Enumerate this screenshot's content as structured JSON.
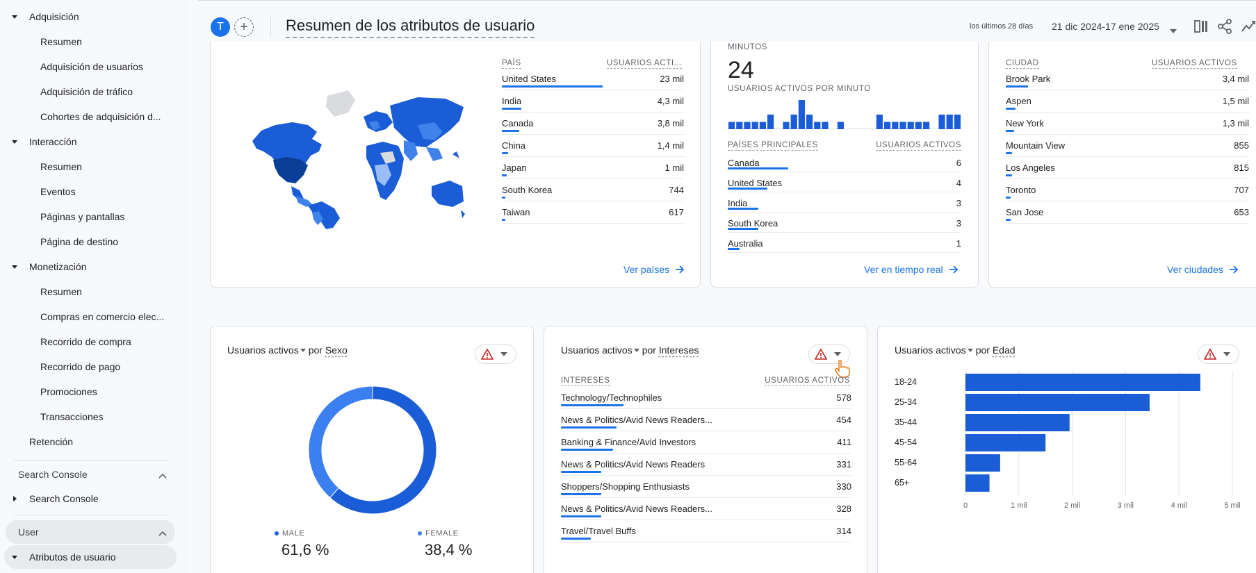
{
  "sidebar": {
    "items": [
      {
        "label": "Adquisición",
        "level": 1,
        "caret": "down"
      },
      {
        "label": "Resumen",
        "level": 2
      },
      {
        "label": "Adquisición de usuarios",
        "level": 2
      },
      {
        "label": "Adquisición de tráfico",
        "level": 2
      },
      {
        "label": "Cohortes de adquisición d...",
        "level": 2
      },
      {
        "label": "Interacción",
        "level": 1,
        "caret": "down"
      },
      {
        "label": "Resumen",
        "level": 2
      },
      {
        "label": "Eventos",
        "level": 2
      },
      {
        "label": "Páginas y pantallas",
        "level": 2
      },
      {
        "label": "Página de destino",
        "level": 2
      },
      {
        "label": "Monetización",
        "level": 1,
        "caret": "down"
      },
      {
        "label": "Resumen",
        "level": 2
      },
      {
        "label": "Compras en comercio elec...",
        "level": 2
      },
      {
        "label": "Recorrido de compra",
        "level": 2
      },
      {
        "label": "Recorrido de pago",
        "level": 2
      },
      {
        "label": "Promociones",
        "level": 2
      },
      {
        "label": "Transacciones",
        "level": 2
      },
      {
        "label": "Retención",
        "level": 1
      }
    ],
    "section_search": "Search Console",
    "search_item": "Search Console",
    "section_user": "User",
    "user_item": "Atributos de usuario"
  },
  "header": {
    "avatar": "T",
    "add": "+",
    "title": "Resumen de los atributos de usuario",
    "date_prefix": "los últimos 28 días",
    "date_range": "21 dic 2024-17 ene 2025"
  },
  "country_card": {
    "col_country": "PAÍS",
    "col_users": "USUARIOS ACTI...",
    "rows": [
      {
        "label": "United States",
        "value": "23 mil",
        "pct": 1.0
      },
      {
        "label": "India",
        "value": "4,3 mil",
        "pct": 0.19
      },
      {
        "label": "Canada",
        "value": "3,8 mil",
        "pct": 0.17
      },
      {
        "label": "China",
        "value": "1,4 mil",
        "pct": 0.06
      },
      {
        "label": "Japan",
        "value": "1 mil",
        "pct": 0.045
      },
      {
        "label": "South Korea",
        "value": "744",
        "pct": 0.035
      },
      {
        "label": "Taiwan",
        "value": "617",
        "pct": 0.03
      }
    ],
    "link": "Ver países"
  },
  "realtime_card": {
    "top_label": "MINUTOS",
    "big_number": "24",
    "per_minute_label": "USUARIOS ACTIVOS POR MINUTO",
    "minute_bars": [
      1,
      1,
      1,
      1,
      1,
      2,
      0,
      1,
      2,
      4,
      2,
      1,
      1,
      0,
      1,
      0,
      0,
      0,
      0,
      2,
      1,
      1,
      1,
      1,
      1,
      1,
      0,
      2,
      2,
      2
    ],
    "col_country": "PAÍSES PRINCIPALES",
    "col_users": "USUARIOS ACTIVOS",
    "rows": [
      {
        "label": "Canada",
        "value": "6",
        "pct": 0.26
      },
      {
        "label": "United States",
        "value": "4",
        "pct": 0.17
      },
      {
        "label": "India",
        "value": "3",
        "pct": 0.13
      },
      {
        "label": "South Korea",
        "value": "3",
        "pct": 0.13
      },
      {
        "label": "Australia",
        "value": "1",
        "pct": 0.05
      }
    ],
    "link": "Ver en tiempo real"
  },
  "city_card": {
    "col_city": "CIUDAD",
    "col_users": "USUARIOS ACTIVOS",
    "rows": [
      {
        "label": "Brook Park",
        "value": "3,4 mil",
        "pct": 0.09
      },
      {
        "label": "Aspen",
        "value": "1,5 mil",
        "pct": 0.04
      },
      {
        "label": "New York",
        "value": "1,3 mil",
        "pct": 0.035
      },
      {
        "label": "Mountain View",
        "value": "855",
        "pct": 0.025
      },
      {
        "label": "Los Angeles",
        "value": "815",
        "pct": 0.025
      },
      {
        "label": "Toronto",
        "value": "707",
        "pct": 0.02
      },
      {
        "label": "San Jose",
        "value": "653",
        "pct": 0.02
      }
    ],
    "link": "Ver ciudades"
  },
  "gender_card": {
    "metric": "Usuarios activos",
    "by": "por",
    "dimension": "Sexo",
    "male_label": "MALE",
    "male_value": "61,6 %",
    "female_label": "FEMALE",
    "female_value": "38,4 %"
  },
  "interests_card": {
    "metric": "Usuarios activos",
    "by": "por",
    "dimension": "Intereses",
    "col_interest": "INTERESES",
    "col_users": "USUARIOS ACTIVOS",
    "rows": [
      {
        "label": "Technology/Technophiles",
        "value": "578",
        "pct": 0.36
      },
      {
        "label": "News & Politics/Avid News Readers...",
        "value": "454",
        "pct": 0.32
      },
      {
        "label": "Banking & Finance/Avid Investors",
        "value": "411",
        "pct": 0.3
      },
      {
        "label": "News & Politics/Avid News Readers",
        "value": "331",
        "pct": 0.23
      },
      {
        "label": "Shoppers/Shopping Enthusiasts",
        "value": "330",
        "pct": 0.23
      },
      {
        "label": "News & Politics/Avid News Readers...",
        "value": "328",
        "pct": 0.23
      },
      {
        "label": "Travel/Travel Buffs",
        "value": "314",
        "pct": 0.17
      }
    ]
  },
  "age_card": {
    "metric": "Usuarios activos",
    "by": "por",
    "dimension": "Edad"
  },
  "chart_data": [
    {
      "type": "pie",
      "categories": [
        "MALE",
        "FEMALE"
      ],
      "values": [
        61.6,
        38.4
      ],
      "colors": [
        "#1a5dd6",
        "#3b7ff0"
      ]
    },
    {
      "type": "bar",
      "orientation": "horizontal",
      "categories": [
        "18-24",
        "25-34",
        "35-44",
        "45-54",
        "55-64",
        "65+"
      ],
      "values": [
        4400,
        3450,
        1950,
        1500,
        650,
        450
      ],
      "xticks": [
        "0",
        "1 mil",
        "2 mil",
        "3 mil",
        "4 mil",
        "5 mil"
      ],
      "xlim": [
        0,
        5000
      ],
      "color": "#1a5dd6"
    },
    {
      "type": "bar",
      "categories": [],
      "values": [
        1,
        1,
        1,
        1,
        1,
        2,
        0,
        1,
        2,
        4,
        2,
        1,
        1,
        0,
        1,
        0,
        0,
        0,
        0,
        2,
        1,
        1,
        1,
        1,
        1,
        1,
        0,
        2,
        2,
        2
      ],
      "color": "#1a5dd6"
    }
  ],
  "colors": {
    "accent": "#1a73e8",
    "bar": "#1a5dd6",
    "warning": "#e8710a"
  },
  "icons": [
    "caret-down-icon",
    "chevron-up-icon",
    "warning-icon",
    "arrow-right-icon",
    "compare-icon",
    "share-icon",
    "insights-icon"
  ]
}
